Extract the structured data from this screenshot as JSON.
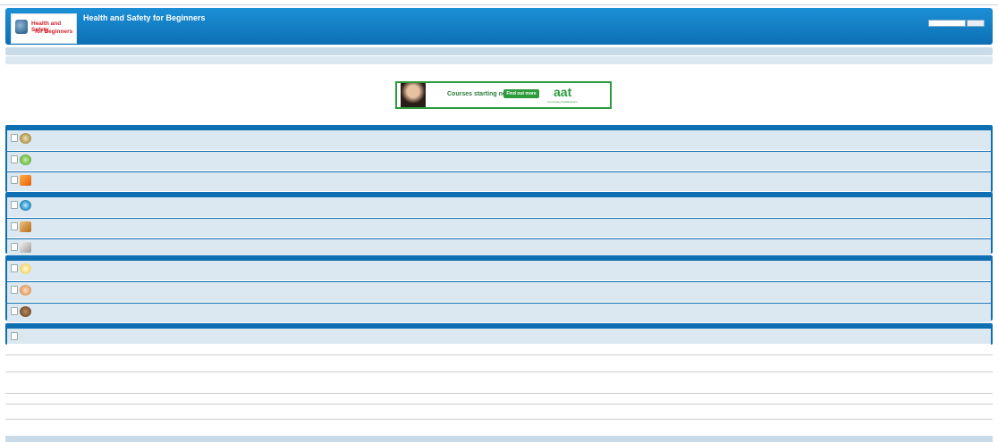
{
  "header": {
    "logo_line1": "Health and Safety",
    "logo_line2": "for Beginners",
    "title": "Health and Safety for Beginners"
  },
  "banner": {
    "text": "Courses starting now",
    "button": "Find out more",
    "brand": "aat",
    "brand_sub": "Accounting Qualifications"
  },
  "colors": {
    "accent": "#0e6fb3",
    "row_bg": "#dce8f1",
    "brand_red": "#d0202c",
    "ad_green": "#2d9b3c"
  },
  "icons": [
    "shield-icon",
    "question-icon",
    "rss-icon",
    "globe-icon",
    "scales-icon",
    "cards-icon",
    "bulb-icon",
    "hand-icon",
    "bear-icon",
    "logo-icon",
    "search-icon"
  ]
}
